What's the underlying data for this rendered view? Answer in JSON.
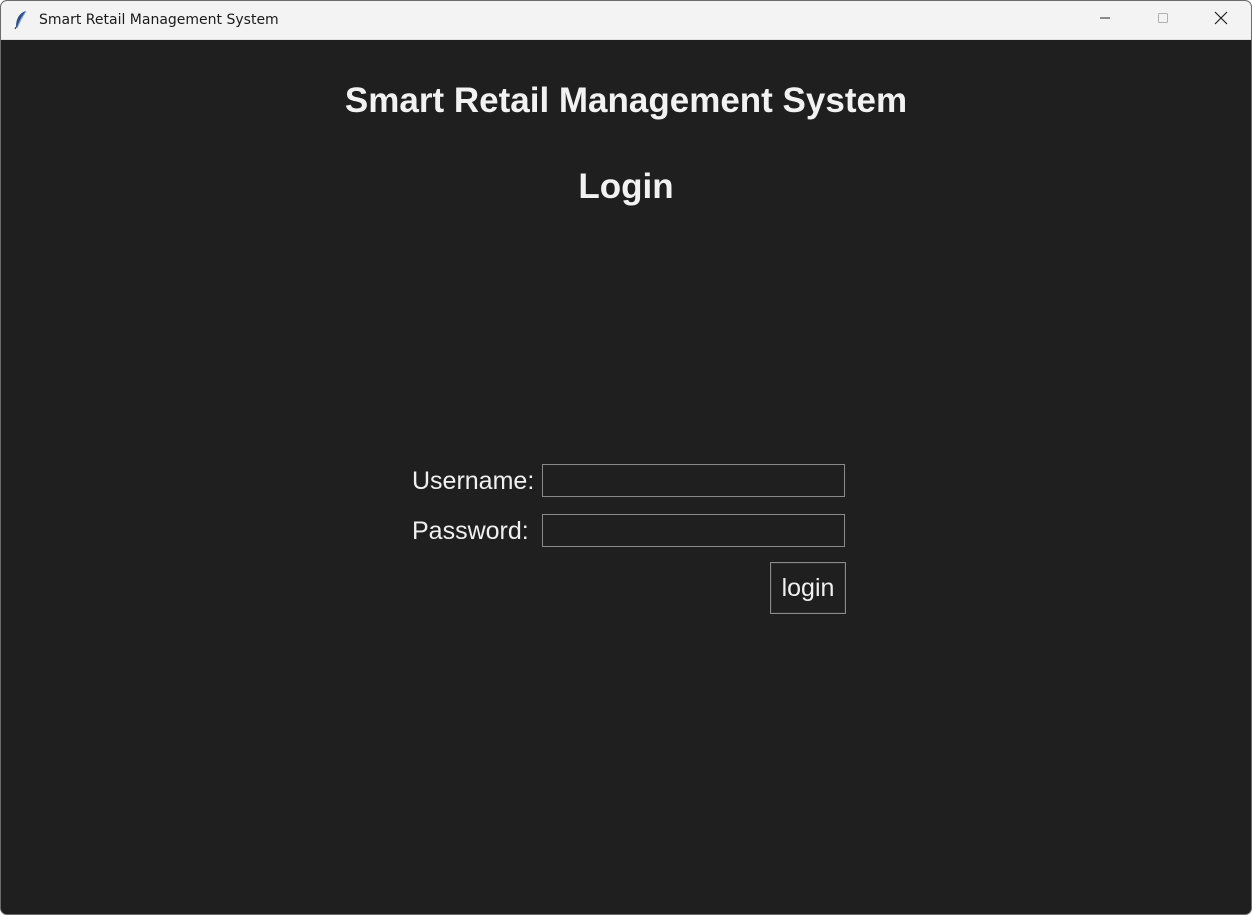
{
  "window": {
    "title": "Smart Retail Management System",
    "icon": "feather-icon"
  },
  "controls": {
    "minimize_icon": "minimize-icon",
    "maximize_icon": "maximize-icon",
    "close_icon": "close-icon"
  },
  "main": {
    "heading": "Smart Retail Management System",
    "subheading": "Login"
  },
  "form": {
    "username_label": "Username:",
    "username_value": "",
    "password_label": "Password:",
    "password_value": "",
    "login_label": "login"
  },
  "colors": {
    "background": "#1f1f1f",
    "titlebar": "#f3f3f3",
    "text": "#f2f2f2",
    "field_border": "#8a8a8a"
  }
}
